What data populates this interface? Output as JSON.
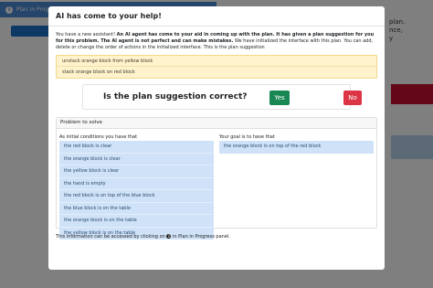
{
  "background": {
    "plan_panel_title": "Plan in Progress",
    "add_button_label": "Add",
    "right_fragments": [
      "plan.",
      "nce,",
      "y"
    ]
  },
  "modal": {
    "title": "AI has come to your help!",
    "intro": {
      "p1": "You have a new assistant! ",
      "b1": "An AI agent has come to your aid in coming up with the plan. It has given a plan suggestion for you for this problem. The AI agent is not perfect and can make mistakes.",
      "p2": " We have initialized the interface with this plan. You can add, delete or change the order of actions in the initialized interface. This is the plan suggestion"
    },
    "plan_suggestions": [
      "unstack orange block from yellow block",
      "stack orange block on red block"
    ],
    "question": "Is the plan suggestion correct?",
    "yes_label": "Yes",
    "no_label": "No",
    "problem": {
      "header": "Problem to solve",
      "initial_label": "As initial conditions you have that",
      "initial_conditions": [
        "the red block is clear",
        "the orange block is clear",
        "the yellow block is clear",
        "the hand is empty",
        "the red block is on top of the blue block",
        "the blue block is on the table",
        "the orange block is on the table",
        "the yellow block is on the table"
      ],
      "goal_label": "Your goal is to have that",
      "goals": [
        "the orange block is on top of the red block"
      ]
    },
    "footer": {
      "before": "This information can be accessed by clicking on ",
      "icon_glyph": "i",
      "after": " in Plan in Progress panel."
    }
  },
  "colors": {
    "yes_button": "#198754",
    "no_button": "#dc3545",
    "suggestion_bg": "#fff3cd",
    "condition_bg": "#cfe2f7",
    "plan_header": "#4a8ad6"
  }
}
